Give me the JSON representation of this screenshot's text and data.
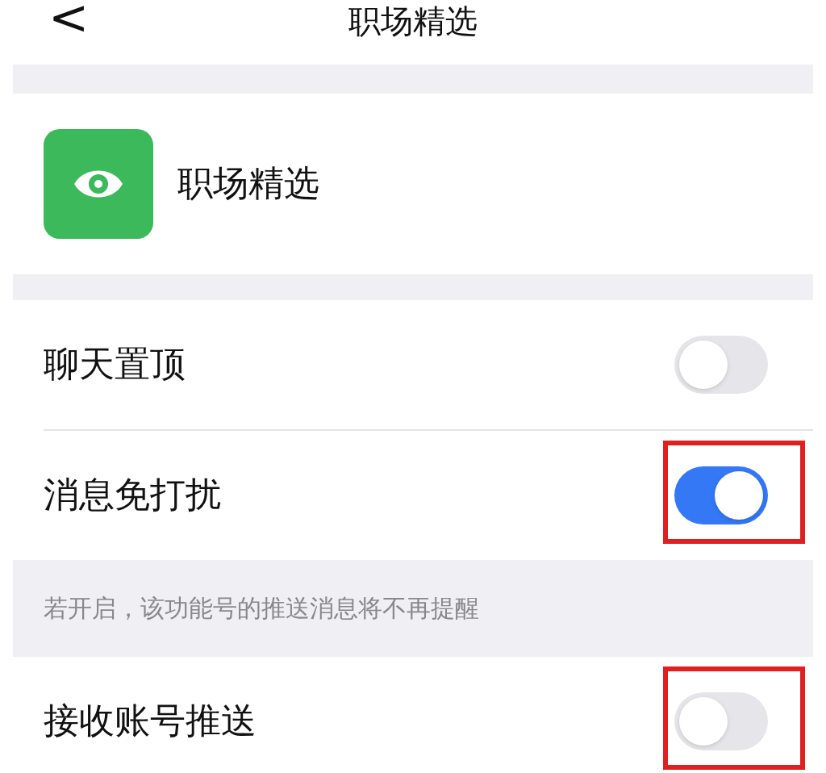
{
  "nav": {
    "back": "<",
    "title": "职场精选"
  },
  "account": {
    "name": "职场精选"
  },
  "settings": [
    {
      "label": "聊天置顶",
      "on": false,
      "highlighted": false
    },
    {
      "label": "消息免打扰",
      "on": true,
      "highlighted": true,
      "note": "若开启，该功能号的推送消息将不再提醒"
    },
    {
      "label": "接收账号推送",
      "on": false,
      "highlighted": true
    }
  ]
}
